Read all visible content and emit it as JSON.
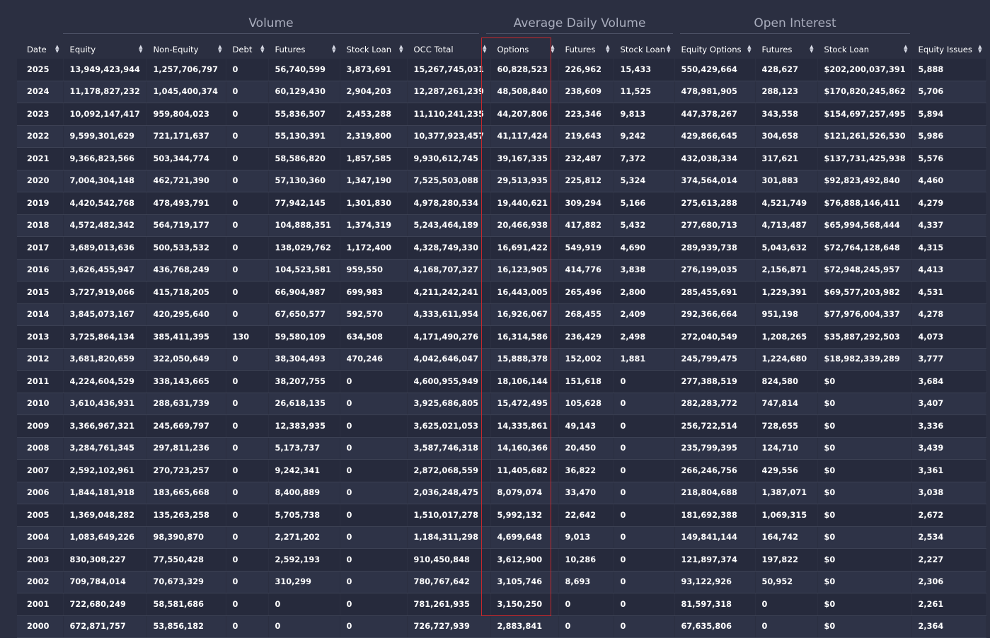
{
  "groups": {
    "volume": "Volume",
    "adv": "Average Daily Volume",
    "oi": "Open Interest"
  },
  "columns": [
    "Date",
    "Equity",
    "Non-Equity",
    "Debt",
    "Futures",
    "Stock Loan",
    "OCC Total",
    "Options",
    "Futures",
    "Stock Loan",
    "Equity Options",
    "Futures",
    "Stock Loan",
    "Equity Issues"
  ],
  "rows": [
    [
      "2025",
      "13,949,423,944",
      "1,257,706,797",
      "0",
      "56,740,599",
      "3,873,691",
      "15,267,745,031",
      "60,828,523",
      "226,962",
      "15,433",
      "550,429,664",
      "428,627",
      "$202,200,037,391",
      "5,888"
    ],
    [
      "2024",
      "11,178,827,232",
      "1,045,400,374",
      "0",
      "60,129,430",
      "2,904,203",
      "12,287,261,239",
      "48,508,840",
      "238,609",
      "11,525",
      "478,981,905",
      "288,123",
      "$170,820,245,862",
      "5,706"
    ],
    [
      "2023",
      "10,092,147,417",
      "959,804,023",
      "0",
      "55,836,507",
      "2,453,288",
      "11,110,241,235",
      "44,207,806",
      "223,346",
      "9,813",
      "447,378,267",
      "343,558",
      "$154,697,257,495",
      "5,894"
    ],
    [
      "2022",
      "9,599,301,629",
      "721,171,637",
      "0",
      "55,130,391",
      "2,319,800",
      "10,377,923,457",
      "41,117,424",
      "219,643",
      "9,242",
      "429,866,645",
      "304,658",
      "$121,261,526,530",
      "5,986"
    ],
    [
      "2021",
      "9,366,823,566",
      "503,344,774",
      "0",
      "58,586,820",
      "1,857,585",
      "9,930,612,745",
      "39,167,335",
      "232,487",
      "7,372",
      "432,038,334",
      "317,621",
      "$137,731,425,938",
      "5,576"
    ],
    [
      "2020",
      "7,004,304,148",
      "462,721,390",
      "0",
      "57,130,360",
      "1,347,190",
      "7,525,503,088",
      "29,513,935",
      "225,812",
      "5,324",
      "374,564,014",
      "301,883",
      "$92,823,492,840",
      "4,460"
    ],
    [
      "2019",
      "4,420,542,768",
      "478,493,791",
      "0",
      "77,942,145",
      "1,301,830",
      "4,978,280,534",
      "19,440,621",
      "309,294",
      "5,166",
      "275,613,288",
      "4,521,749",
      "$76,888,146,411",
      "4,279"
    ],
    [
      "2018",
      "4,572,482,342",
      "564,719,177",
      "0",
      "104,888,351",
      "1,374,319",
      "5,243,464,189",
      "20,466,938",
      "417,882",
      "5,432",
      "277,680,713",
      "4,713,487",
      "$65,994,568,444",
      "4,337"
    ],
    [
      "2017",
      "3,689,013,636",
      "500,533,532",
      "0",
      "138,029,762",
      "1,172,400",
      "4,328,749,330",
      "16,691,422",
      "549,919",
      "4,690",
      "289,939,738",
      "5,043,632",
      "$72,764,128,648",
      "4,315"
    ],
    [
      "2016",
      "3,626,455,947",
      "436,768,249",
      "0",
      "104,523,581",
      "959,550",
      "4,168,707,327",
      "16,123,905",
      "414,776",
      "3,838",
      "276,199,035",
      "2,156,871",
      "$72,948,245,957",
      "4,413"
    ],
    [
      "2015",
      "3,727,919,066",
      "415,718,205",
      "0",
      "66,904,987",
      "699,983",
      "4,211,242,241",
      "16,443,005",
      "265,496",
      "2,800",
      "285,455,691",
      "1,229,391",
      "$69,577,203,982",
      "4,531"
    ],
    [
      "2014",
      "3,845,073,167",
      "420,295,640",
      "0",
      "67,650,577",
      "592,570",
      "4,333,611,954",
      "16,926,067",
      "268,455",
      "2,409",
      "292,366,664",
      "951,198",
      "$77,976,004,337",
      "4,278"
    ],
    [
      "2013",
      "3,725,864,134",
      "385,411,395",
      "130",
      "59,580,109",
      "634,508",
      "4,171,490,276",
      "16,314,586",
      "236,429",
      "2,498",
      "272,040,549",
      "1,208,265",
      "$35,887,292,503",
      "4,073"
    ],
    [
      "2012",
      "3,681,820,659",
      "322,050,649",
      "0",
      "38,304,493",
      "470,246",
      "4,042,646,047",
      "15,888,378",
      "152,002",
      "1,881",
      "245,799,475",
      "1,224,680",
      "$18,982,339,289",
      "3,777"
    ],
    [
      "2011",
      "4,224,604,529",
      "338,143,665",
      "0",
      "38,207,755",
      "0",
      "4,600,955,949",
      "18,106,144",
      "151,618",
      "0",
      "277,388,519",
      "824,580",
      "$0",
      "3,684"
    ],
    [
      "2010",
      "3,610,436,931",
      "288,631,739",
      "0",
      "26,618,135",
      "0",
      "3,925,686,805",
      "15,472,495",
      "105,628",
      "0",
      "282,283,772",
      "747,814",
      "$0",
      "3,407"
    ],
    [
      "2009",
      "3,366,967,321",
      "245,669,797",
      "0",
      "12,383,935",
      "0",
      "3,625,021,053",
      "14,335,861",
      "49,143",
      "0",
      "256,722,514",
      "728,655",
      "$0",
      "3,336"
    ],
    [
      "2008",
      "3,284,761,345",
      "297,811,236",
      "0",
      "5,173,737",
      "0",
      "3,587,746,318",
      "14,160,366",
      "20,450",
      "0",
      "235,799,395",
      "124,710",
      "$0",
      "3,439"
    ],
    [
      "2007",
      "2,592,102,961",
      "270,723,257",
      "0",
      "9,242,341",
      "0",
      "2,872,068,559",
      "11,405,682",
      "36,822",
      "0",
      "266,246,756",
      "429,556",
      "$0",
      "3,361"
    ],
    [
      "2006",
      "1,844,181,918",
      "183,665,668",
      "0",
      "8,400,889",
      "0",
      "2,036,248,475",
      "8,079,074",
      "33,470",
      "0",
      "218,804,688",
      "1,387,071",
      "$0",
      "3,038"
    ],
    [
      "2005",
      "1,369,048,282",
      "135,263,258",
      "0",
      "5,705,738",
      "0",
      "1,510,017,278",
      "5,992,132",
      "22,642",
      "0",
      "181,692,388",
      "1,069,315",
      "$0",
      "2,672"
    ],
    [
      "2004",
      "1,083,649,226",
      "98,390,870",
      "0",
      "2,271,202",
      "0",
      "1,184,311,298",
      "4,699,648",
      "9,013",
      "0",
      "149,841,144",
      "164,742",
      "$0",
      "2,534"
    ],
    [
      "2003",
      "830,308,227",
      "77,550,428",
      "0",
      "2,592,193",
      "0",
      "910,450,848",
      "3,612,900",
      "10,286",
      "0",
      "121,897,374",
      "197,822",
      "$0",
      "2,227"
    ],
    [
      "2002",
      "709,784,014",
      "70,673,329",
      "0",
      "310,299",
      "0",
      "780,767,642",
      "3,105,746",
      "8,693",
      "0",
      "93,122,926",
      "50,952",
      "$0",
      "2,306"
    ],
    [
      "2001",
      "722,680,249",
      "58,581,686",
      "0",
      "0",
      "0",
      "781,261,935",
      "3,150,250",
      "0",
      "0",
      "81,597,318",
      "0",
      "$0",
      "2,261"
    ],
    [
      "2000",
      "672,871,757",
      "53,856,182",
      "0",
      "0",
      "0",
      "726,727,939",
      "2,883,841",
      "0",
      "0",
      "67,635,806",
      "0",
      "$0",
      "2,364"
    ]
  ],
  "colors": {
    "background": "#2b2f41",
    "highlight_border": "#c4282d"
  }
}
